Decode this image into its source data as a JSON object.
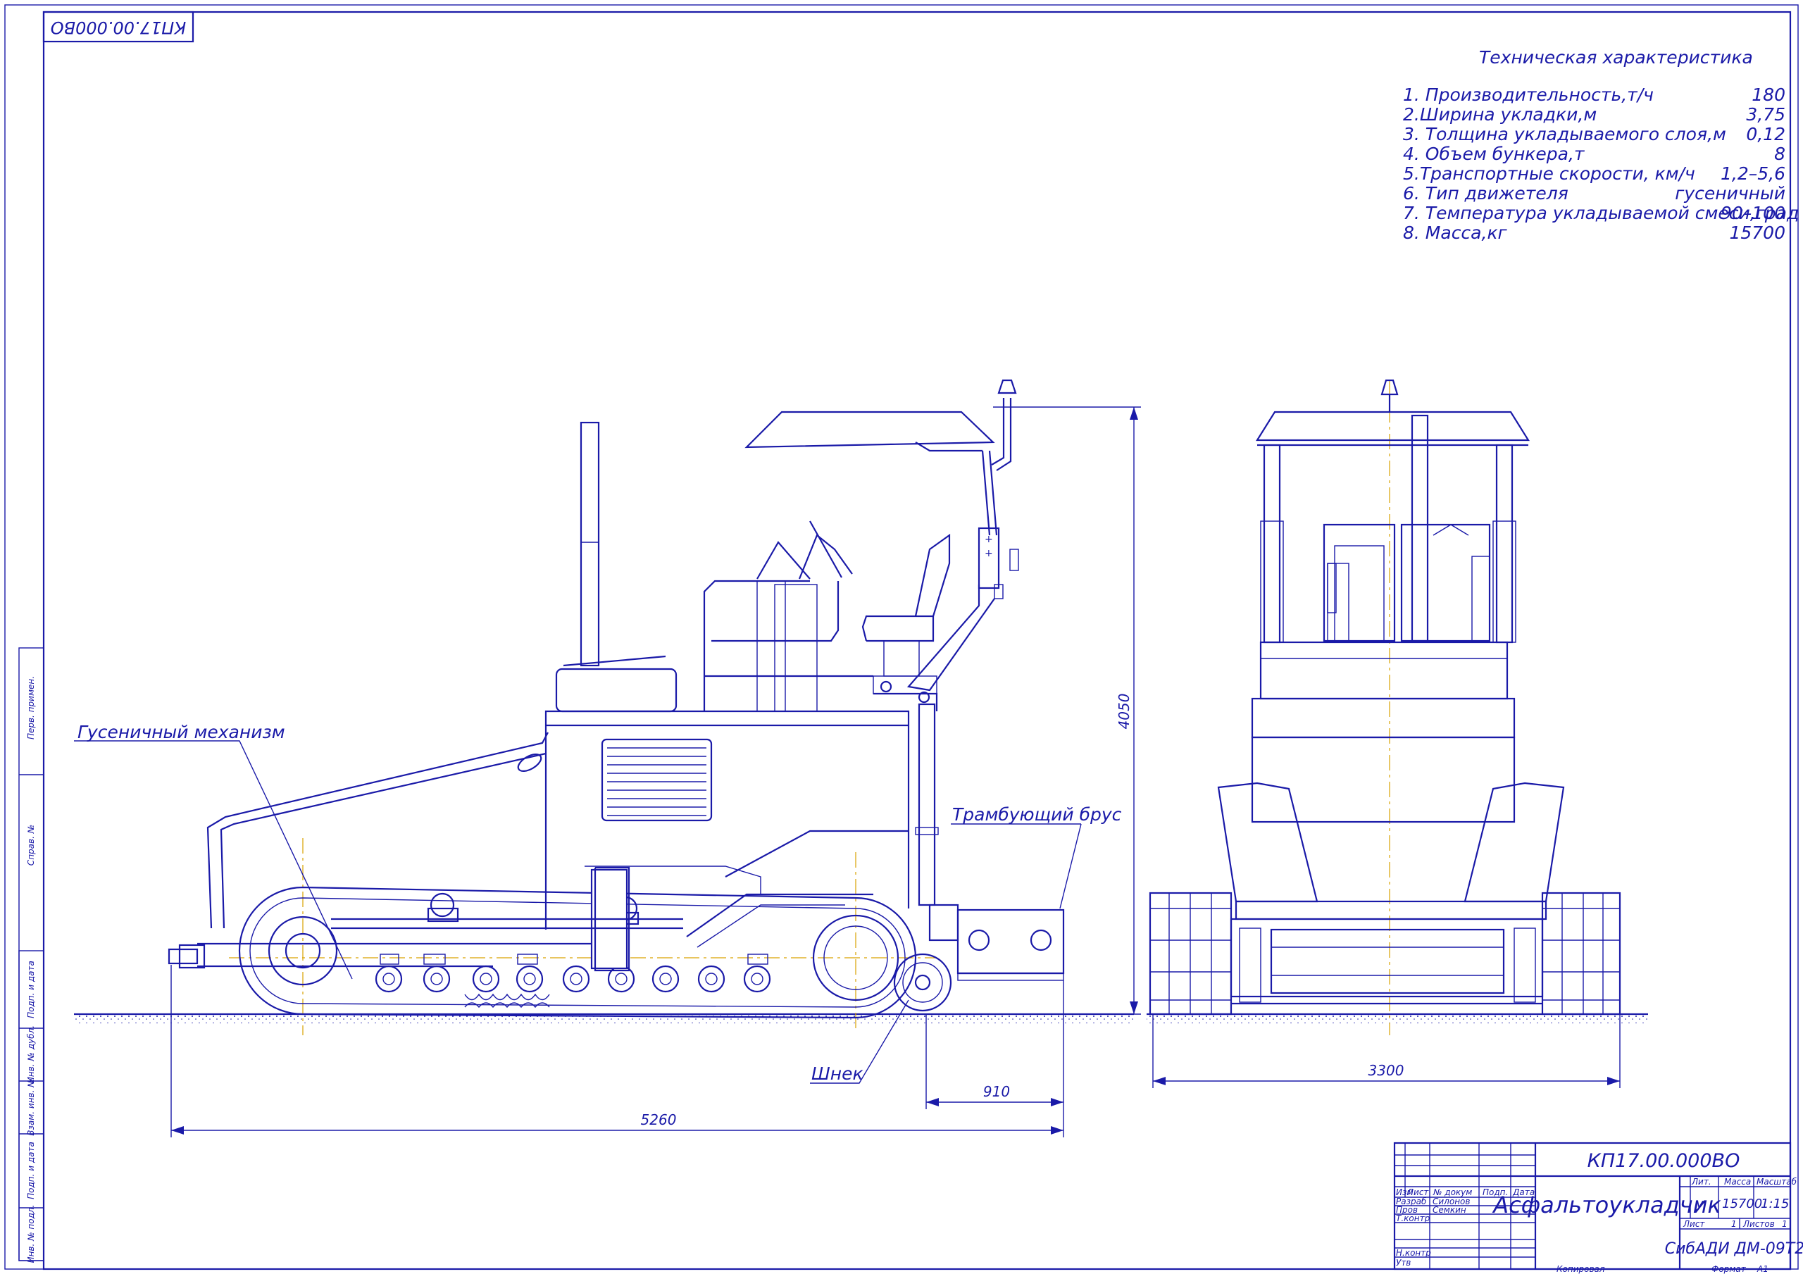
{
  "drawing_code": "КП17.00.000ВО",
  "drawing_code_rotated": "КП17.00.000ВО",
  "spec_title": "Техническая характеристика",
  "specs": [
    {
      "label": "1. Производительность,т/ч",
      "value": "180"
    },
    {
      "label": "2.Ширина укладки,м",
      "value": "3,75"
    },
    {
      "label": "3. Толщина укладываемого слоя,м",
      "value": "0,12"
    },
    {
      "label": "4. Объем бункера,т",
      "value": "8"
    },
    {
      "label": "5.Транспортные скорости, км/ч",
      "value": "1,2–5,6"
    },
    {
      "label": "6. Тип движетеля",
      "value": "гусеничный"
    },
    {
      "label": "7. Температура укладываемой смеси,град",
      "value": "90–100"
    },
    {
      "label": "8. Масса,кг",
      "value": "15700"
    }
  ],
  "callouts": {
    "track": "Гусеничный механизм",
    "tamper": "Трамбующий брус",
    "auger": "Шнек"
  },
  "dimensions": {
    "height": "4050",
    "overall_length": "5260",
    "rear_overhang": "910",
    "width": "3300"
  },
  "side_stamp": [
    "Перв. примен.",
    "Справ. №",
    "Подп. и дата",
    "Инв. № дубл.",
    "Взам. инв. №",
    "Подп. и дата",
    "Инв. № подл."
  ],
  "title_block": {
    "code": "КП17.00.000ВО",
    "name": "Асфальтоукладчик",
    "col_headers": [
      "Изм",
      "Лист",
      "№ докум",
      "Подп.",
      "Дата"
    ],
    "row_labels": [
      "Разраб",
      "Пров",
      "Т.контр",
      "Н.контр",
      "Утв"
    ],
    "developer": "Силонов",
    "checker": "Семкин",
    "lit_label": "Лит.",
    "mass_label": "Масса",
    "scale_label": "Масштаб",
    "lit_value": "у",
    "mass_value": "15700",
    "scale_value": "1:15",
    "sheet_label": "Лист",
    "sheet_value": "1",
    "sheets_label": "Листов",
    "sheets_value": "1",
    "org": "СибАДИ ДМ-09Т2",
    "copied": "Копировал",
    "format_label": "Формат",
    "format_value": "А1"
  }
}
